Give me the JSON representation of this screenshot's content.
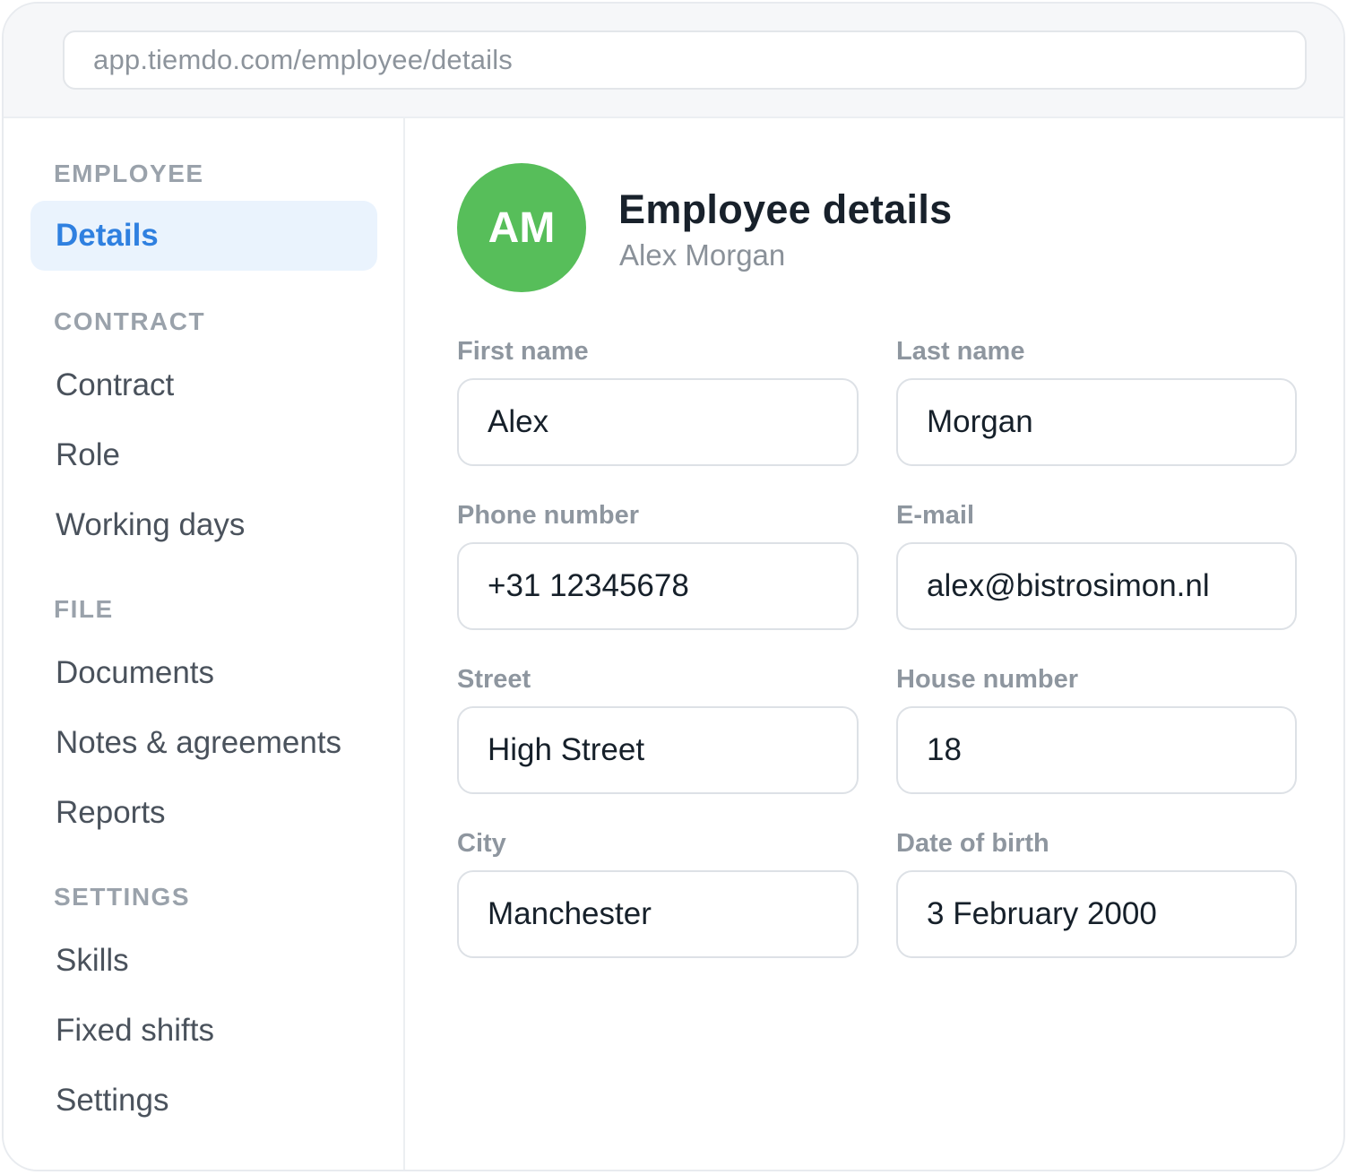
{
  "browser": {
    "url": "app.tiemdo.com/employee/details"
  },
  "sidebar": {
    "sections": [
      {
        "title": "EMPLOYEE",
        "items": [
          "Details"
        ]
      },
      {
        "title": "CONTRACT",
        "items": [
          "Contract",
          "Role",
          "Working days"
        ]
      },
      {
        "title": "FILE",
        "items": [
          "Documents",
          "Notes & agreements",
          "Reports"
        ]
      },
      {
        "title": "SETTINGS",
        "items": [
          "Skills",
          "Fixed shifts",
          "Settings"
        ]
      }
    ],
    "active_item": "Details"
  },
  "header": {
    "avatar_initials": "AM",
    "avatar_color": "#57be5a",
    "title": "Employee details",
    "subtitle": "Alex Morgan"
  },
  "form": {
    "first_name": {
      "label": "First name",
      "value": "Alex"
    },
    "last_name": {
      "label": "Last name",
      "value": "Morgan"
    },
    "phone": {
      "label": "Phone number",
      "value": "+31 12345678"
    },
    "email": {
      "label": "E-mail",
      "value": "alex@bistrosimon.nl"
    },
    "street": {
      "label": "Street",
      "value": "High Street"
    },
    "house_number": {
      "label": "House number",
      "value": "18"
    },
    "city": {
      "label": "City",
      "value": "Manchester"
    },
    "date_of_birth": {
      "label": "Date of birth",
      "value": "3 February 2000"
    }
  },
  "colors": {
    "accent": "#2f80e0",
    "active_bg": "#eaf3fd"
  }
}
